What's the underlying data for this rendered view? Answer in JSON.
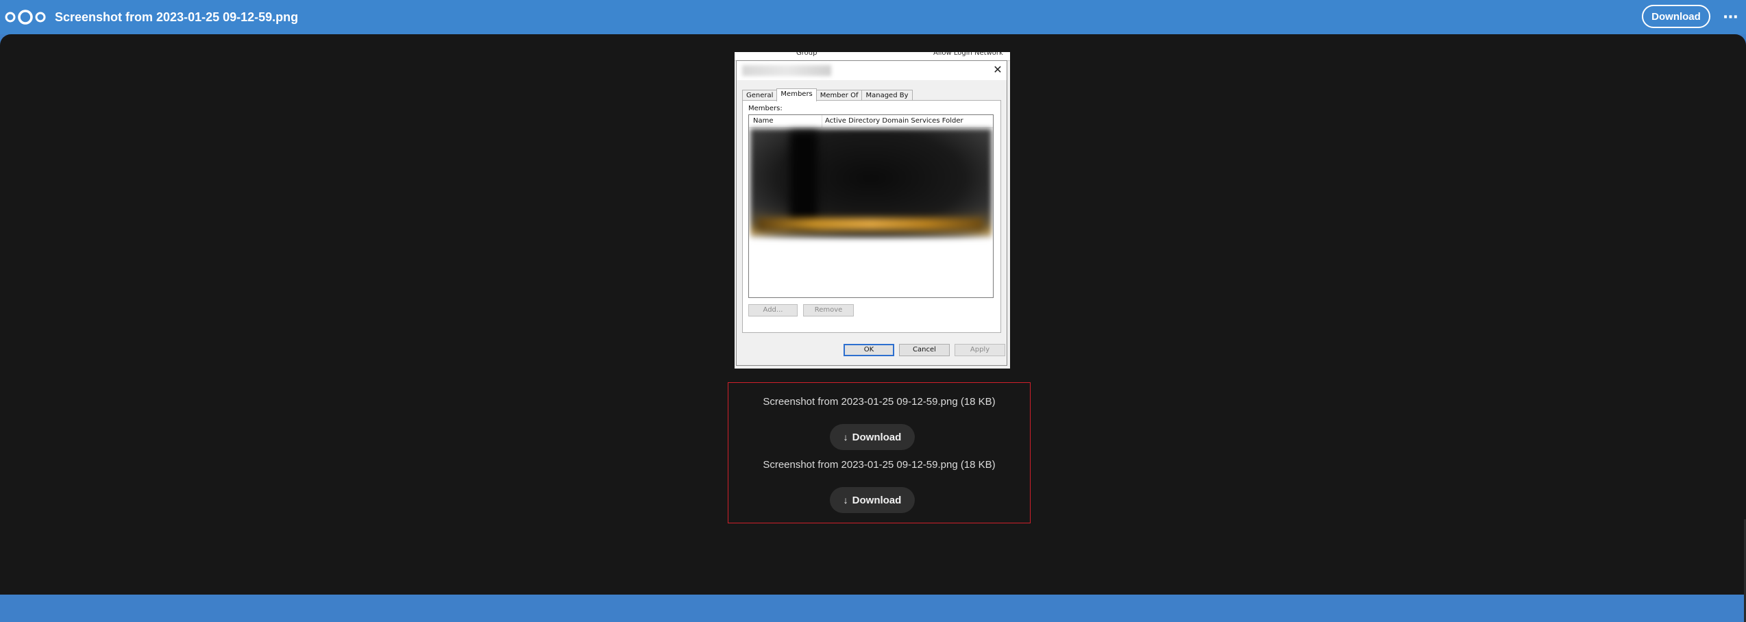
{
  "header": {
    "logo_icon": "nextcloud-logo-icon",
    "file_title": "Screenshot from 2023-01-25 09-12-59.png",
    "download_label": "Download",
    "menu_glyph": "⋯"
  },
  "screenshot": {
    "top_strip_left": "Group",
    "top_strip_right": "Allow Login Network",
    "close_glyph": "✕",
    "tabs": [
      {
        "label": "General"
      },
      {
        "label": "Members"
      },
      {
        "label": "Member Of"
      },
      {
        "label": "Managed By"
      }
    ],
    "members_label": "Members:",
    "columns": {
      "name": "Name",
      "folder": "Active Directory Domain Services Folder"
    },
    "buttons": {
      "add": "Add...",
      "remove": "Remove",
      "ok": "OK",
      "cancel": "Cancel",
      "apply": "Apply"
    }
  },
  "attachments": [
    {
      "name": "Screenshot from 2023-01-25 09-12-59.png (18 KB)",
      "download_label": "Download",
      "icon": "download-arrow-icon"
    },
    {
      "name": "Screenshot from 2023-01-25 09-12-59.png (18 KB)",
      "download_label": "Download",
      "icon": "download-arrow-icon"
    }
  ],
  "colors": {
    "header_bg": "#3d86cf",
    "viewer_bg": "#171717",
    "attachment_border": "#d0202a",
    "button_bg": "#2f2f2f"
  }
}
